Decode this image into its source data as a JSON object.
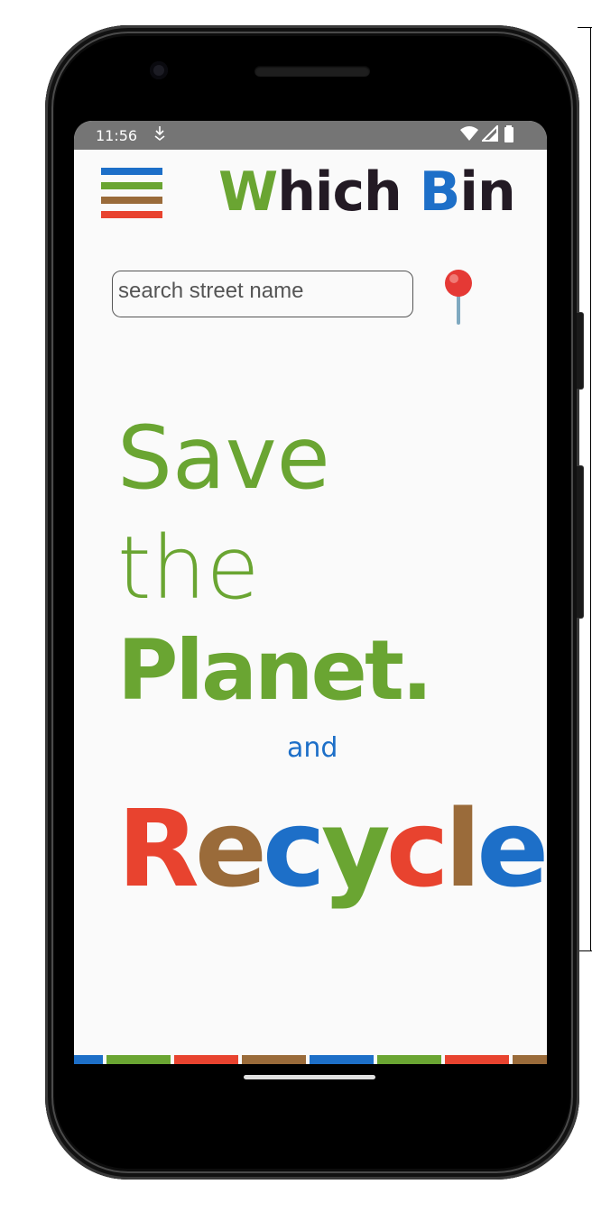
{
  "status_bar": {
    "time": "11:56",
    "icons": [
      "download-notification-icon",
      "wifi-icon",
      "cell-signal-icon",
      "battery-icon"
    ]
  },
  "header": {
    "menu_icon": "hamburger-menu-icon",
    "menu_bar_colors": [
      "#1d6fc8",
      "#6aa532",
      "#9a6b3a",
      "#e8432f"
    ],
    "title_parts": [
      {
        "text": "W",
        "color": "#6aa532"
      },
      {
        "text": "hich ",
        "color": "#231a24"
      },
      {
        "text": "B",
        "color": "#1d6fc8"
      },
      {
        "text": "in",
        "color": "#231a24"
      }
    ]
  },
  "search": {
    "placeholder": "search street name",
    "value": "",
    "location_icon": "map-pin-icon"
  },
  "hero": {
    "line1": "Save",
    "line2": "the",
    "line3": "Planet.",
    "connector": "and",
    "recycle_letters": [
      {
        "text": "R",
        "color": "#e8432f"
      },
      {
        "text": "e",
        "color": "#9a6b3a"
      },
      {
        "text": "c",
        "color": "#1d6fc8"
      },
      {
        "text": "y",
        "color": "#6aa532"
      },
      {
        "text": "c",
        "color": "#e8432f"
      },
      {
        "text": "l",
        "color": "#9a6b3a"
      },
      {
        "text": "e",
        "color": "#1d6fc8"
      }
    ]
  },
  "colors": {
    "green": "#6aa532",
    "blue": "#1d6fc8",
    "brown": "#9a6b3a",
    "red": "#e8432f",
    "dark": "#231a24",
    "statusbar": "#757575"
  },
  "footer_stripe_colors": [
    "#1d6fc8",
    "#6aa532",
    "#e8432f",
    "#9a6b3a",
    "#1d6fc8",
    "#6aa532",
    "#e8432f",
    "#9a6b3a"
  ]
}
